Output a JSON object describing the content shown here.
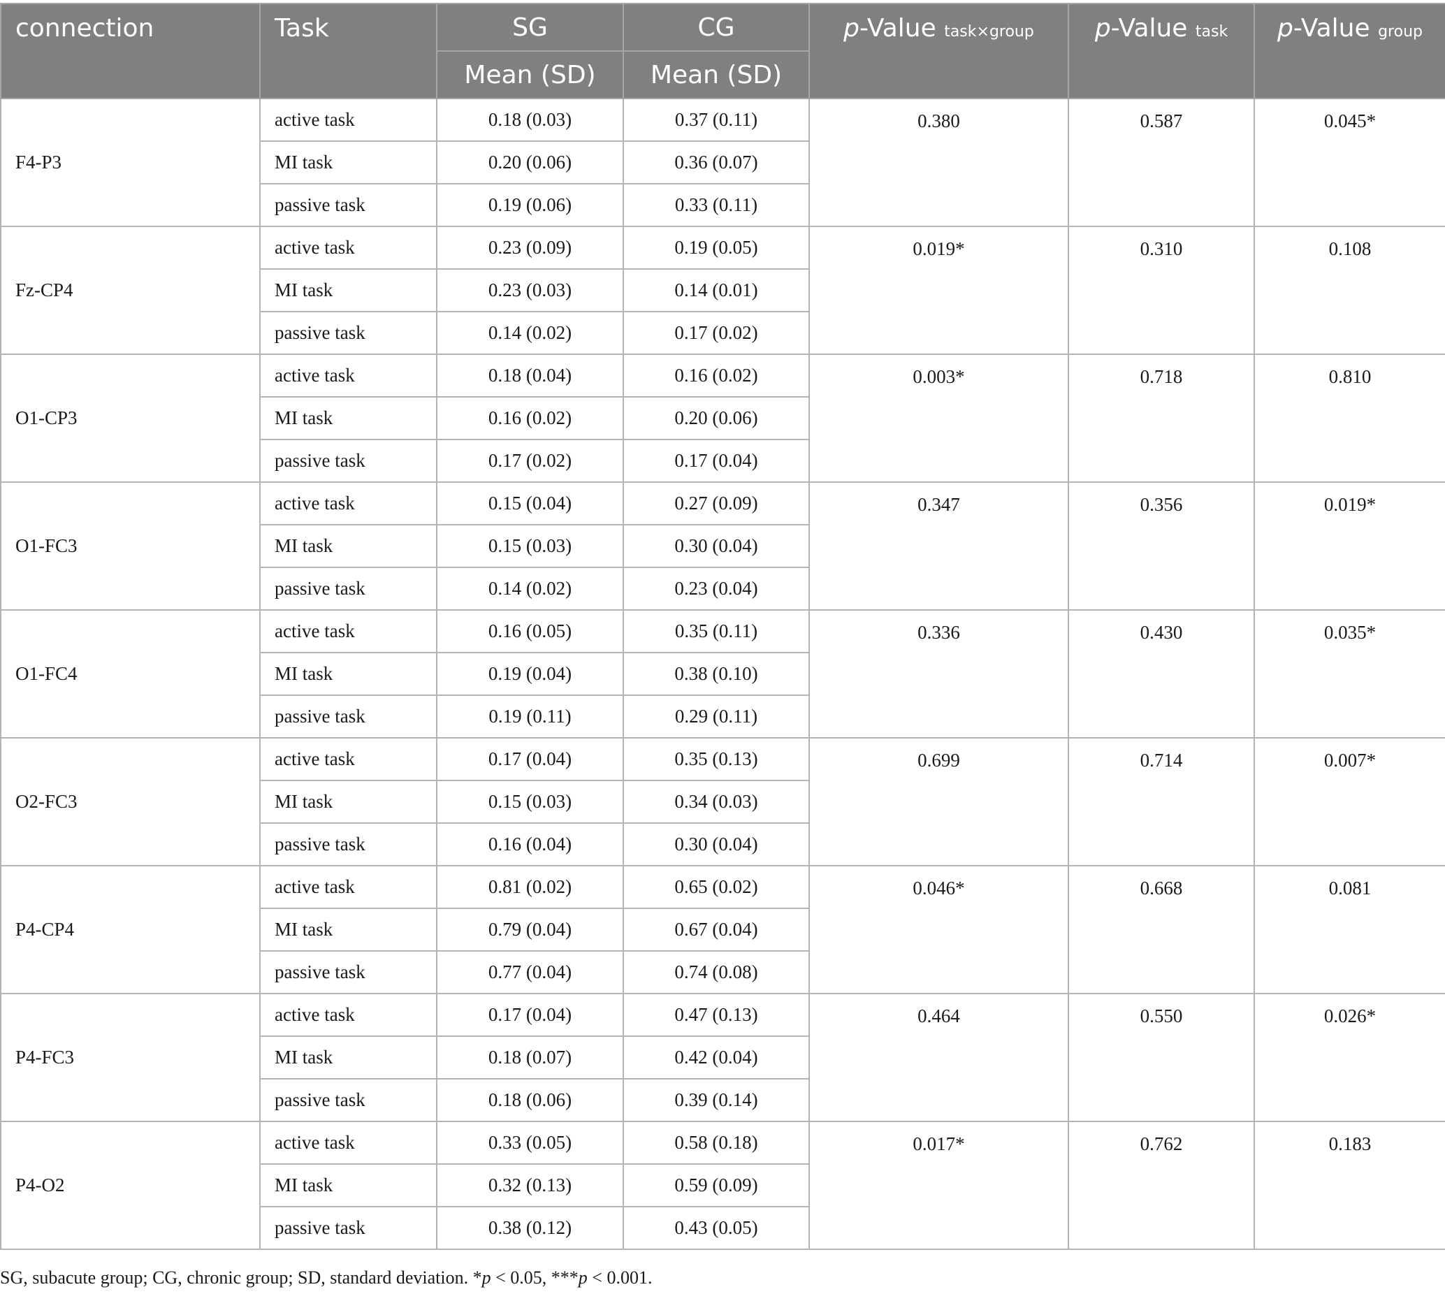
{
  "header": {
    "connection": "connection",
    "task": "Task",
    "sg": "SG",
    "cg": "CG",
    "sg_sub": "Mean (SD)",
    "cg_sub": "Mean (SD)",
    "p_int": {
      "p": "p",
      "label": "-Value",
      "sub": "task×group"
    },
    "p_task": {
      "p": "p",
      "label": "-Value",
      "sub": "task"
    },
    "p_group": {
      "p": "p",
      "label": "-Value",
      "sub": "group"
    }
  },
  "rows": [
    {
      "connection": "F4-P3",
      "p_int": "0.380",
      "p_task": "0.587",
      "p_group": "0.045*",
      "tasks": [
        {
          "task": "active task",
          "sg": "0.18 (0.03)",
          "cg": "0.37 (0.11)"
        },
        {
          "task": "MI task",
          "sg": "0.20 (0.06)",
          "cg": "0.36 (0.07)"
        },
        {
          "task": "passive task",
          "sg": "0.19 (0.06)",
          "cg": "0.33 (0.11)"
        }
      ]
    },
    {
      "connection": "Fz-CP4",
      "p_int": "0.019*",
      "p_task": "0.310",
      "p_group": "0.108",
      "tasks": [
        {
          "task": "active task",
          "sg": "0.23 (0.09)",
          "cg": "0.19 (0.05)"
        },
        {
          "task": "MI task",
          "sg": "0.23 (0.03)",
          "cg": "0.14 (0.01)"
        },
        {
          "task": "passive task",
          "sg": "0.14 (0.02)",
          "cg": "0.17 (0.02)"
        }
      ]
    },
    {
      "connection": "O1-CP3",
      "p_int": "0.003*",
      "p_task": "0.718",
      "p_group": "0.810",
      "tasks": [
        {
          "task": "active task",
          "sg": "0.18 (0.04)",
          "cg": "0.16 (0.02)"
        },
        {
          "task": "MI task",
          "sg": "0.16 (0.02)",
          "cg": "0.20 (0.06)"
        },
        {
          "task": "passive task",
          "sg": "0.17 (0.02)",
          "cg": "0.17 (0.04)"
        }
      ]
    },
    {
      "connection": "O1-FC3",
      "p_int": "0.347",
      "p_task": "0.356",
      "p_group": "0.019*",
      "tasks": [
        {
          "task": "active task",
          "sg": "0.15 (0.04)",
          "cg": "0.27 (0.09)"
        },
        {
          "task": "MI task",
          "sg": "0.15 (0.03)",
          "cg": "0.30 (0.04)"
        },
        {
          "task": "passive task",
          "sg": "0.14 (0.02)",
          "cg": "0.23 (0.04)"
        }
      ]
    },
    {
      "connection": "O1-FC4",
      "p_int": "0.336",
      "p_task": "0.430",
      "p_group": "0.035*",
      "tasks": [
        {
          "task": "active task",
          "sg": "0.16 (0.05)",
          "cg": "0.35 (0.11)"
        },
        {
          "task": "MI task",
          "sg": "0.19 (0.04)",
          "cg": "0.38 (0.10)"
        },
        {
          "task": "passive task",
          "sg": "0.19 (0.11)",
          "cg": "0.29 (0.11)"
        }
      ]
    },
    {
      "connection": "O2-FC3",
      "p_int": "0.699",
      "p_task": "0.714",
      "p_group": "0.007*",
      "tasks": [
        {
          "task": "active task",
          "sg": "0.17 (0.04)",
          "cg": "0.35 (0.13)"
        },
        {
          "task": "MI task",
          "sg": "0.15 (0.03)",
          "cg": "0.34 (0.03)"
        },
        {
          "task": "passive task",
          "sg": "0.16 (0.04)",
          "cg": "0.30 (0.04)"
        }
      ]
    },
    {
      "connection": "P4-CP4",
      "p_int": "0.046*",
      "p_task": "0.668",
      "p_group": "0.081",
      "tasks": [
        {
          "task": "active task",
          "sg": "0.81 (0.02)",
          "cg": "0.65 (0.02)"
        },
        {
          "task": "MI task",
          "sg": "0.79 (0.04)",
          "cg": "0.67 (0.04)"
        },
        {
          "task": "passive task",
          "sg": "0.77 (0.04)",
          "cg": "0.74 (0.08)"
        }
      ]
    },
    {
      "connection": "P4-FC3",
      "p_int": "0.464",
      "p_task": "0.550",
      "p_group": "0.026*",
      "tasks": [
        {
          "task": "active task",
          "sg": "0.17 (0.04)",
          "cg": "0.47 (0.13)"
        },
        {
          "task": "MI task",
          "sg": "0.18 (0.07)",
          "cg": "0.42 (0.04)"
        },
        {
          "task": "passive task",
          "sg": "0.18 (0.06)",
          "cg": "0.39 (0.14)"
        }
      ]
    },
    {
      "connection": "P4-O2",
      "p_int": "0.017*",
      "p_task": "0.762",
      "p_group": "0.183",
      "tasks": [
        {
          "task": "active task",
          "sg": "0.33 (0.05)",
          "cg": "0.58 (0.18)"
        },
        {
          "task": "MI task",
          "sg": "0.32 (0.13)",
          "cg": "0.59 (0.09)"
        },
        {
          "task": "passive task",
          "sg": "0.38 (0.12)",
          "cg": "0.43 (0.05)"
        }
      ]
    }
  ],
  "footnote": {
    "text": "SG, subacute group; CG, chronic group; SD, standard deviation. *",
    "p1": "p",
    "t1": " < 0.05, ***",
    "p2": "p",
    "t2": " < 0.001."
  }
}
